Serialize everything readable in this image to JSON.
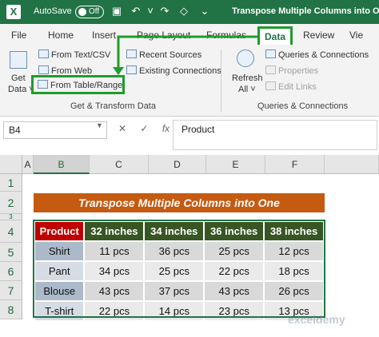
{
  "titlebar": {
    "logo": "X",
    "autosave_label": "AutoSave",
    "autosave_state": "Off",
    "doc_title": "Transpose Multiple Columns into O..."
  },
  "tabs": [
    "File",
    "Home",
    "Insert",
    "Page Layout",
    "Formulas",
    "Data",
    "Review",
    "Vie"
  ],
  "active_tab": "Data",
  "ribbon": {
    "get_data": {
      "line1": "Get",
      "line2": "Data ˅"
    },
    "get_transform_items": [
      "From Text/CSV",
      "From Web",
      "From Table/Range"
    ],
    "recent": [
      "Recent Sources",
      "Existing Connections"
    ],
    "group1_label": "Get & Transform Data",
    "refresh": {
      "line1": "Refresh",
      "line2": "All ˅"
    },
    "queries_items": [
      "Queries & Connections",
      "Properties",
      "Edit Links"
    ],
    "group2_label": "Queries & Connections"
  },
  "formula_bar": {
    "name_box": "B4",
    "cancel": "✕",
    "enter": "✓",
    "fx": "fx",
    "content": "Product"
  },
  "columns": [
    "A",
    "B",
    "C",
    "D",
    "E",
    "F"
  ],
  "rows": [
    "1",
    "2",
    "3",
    "4",
    "5",
    "6",
    "7",
    "8"
  ],
  "banner": "Transpose Multiple Columns into One",
  "table": {
    "headers": [
      "Product",
      "32 inches",
      "34 inches",
      "36 inches",
      "38 inches"
    ],
    "rows": [
      [
        "Shirt",
        "11 pcs",
        "36 pcs",
        "25 pcs",
        "12 pcs"
      ],
      [
        "Pant",
        "34 pcs",
        "25 pcs",
        "22 pcs",
        "18 pcs"
      ],
      [
        "Blouse",
        "43 pcs",
        "37 pcs",
        "43 pcs",
        "26 pcs"
      ],
      [
        "T-shirt",
        "22 pcs",
        "14 pcs",
        "23 pcs",
        "13 pcs"
      ]
    ]
  },
  "watermark": "exceldemy",
  "colors": {
    "excel_green": "#217346",
    "highlight_green": "#1f9d2a",
    "banner": "#c55a11",
    "product_header": "#c00000",
    "size_header": "#375623"
  }
}
